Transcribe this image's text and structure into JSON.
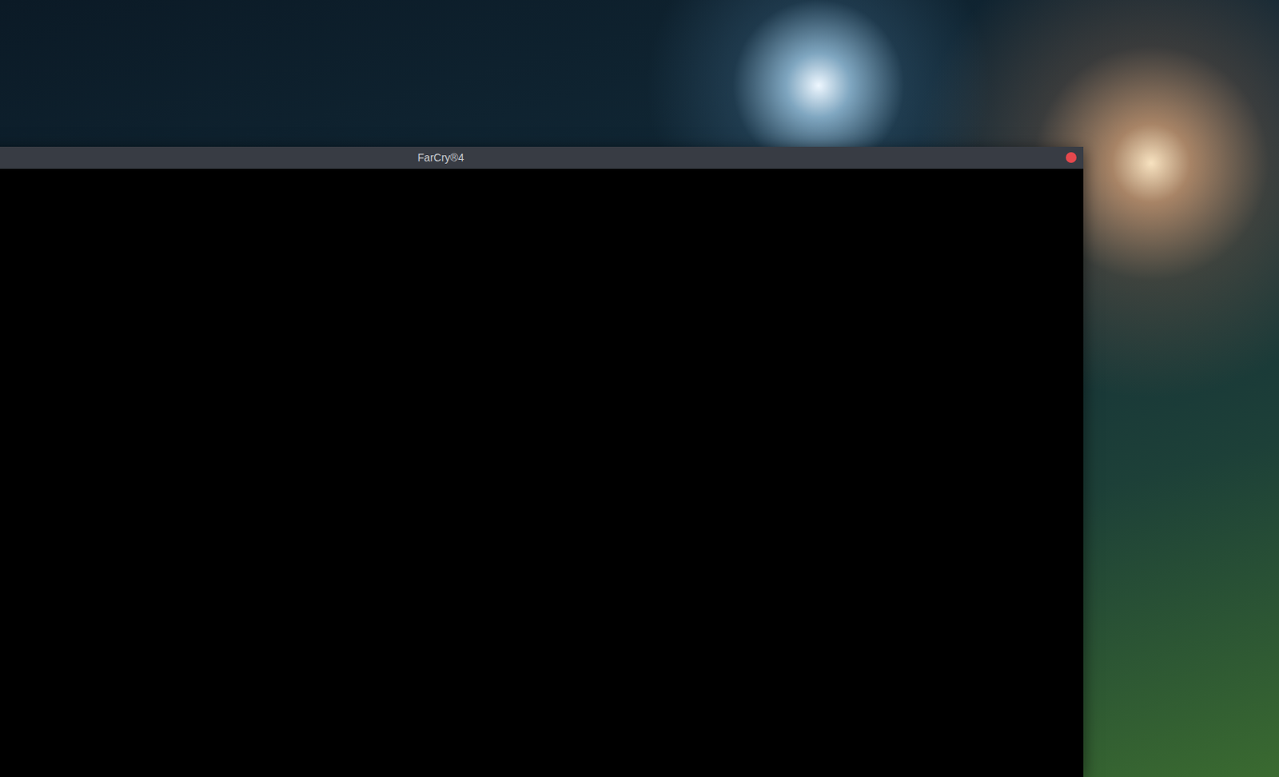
{
  "window": {
    "title": "FarCry®4"
  }
}
